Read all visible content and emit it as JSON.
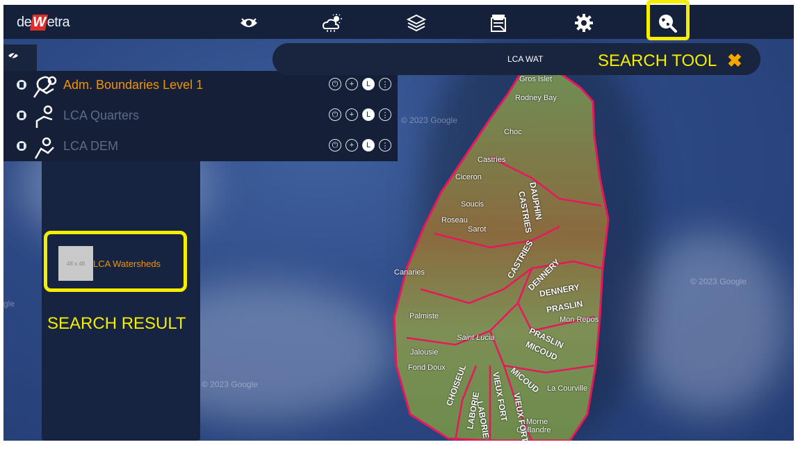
{
  "app": {
    "logo_prefix": "de",
    "logo_mark": "W",
    "logo_suffix": "etra"
  },
  "toolbar": {
    "icons": [
      "eye-icon",
      "weather-icon",
      "layers-icon",
      "documents-icon",
      "gear-icon",
      "globe-search-icon"
    ]
  },
  "search": {
    "query": "LCA WAT",
    "tool_label": "SEARCH TOOL",
    "close_glyph": "✖"
  },
  "layers": [
    {
      "name": "Adm. Boundaries Level 1",
      "color": "#f39200"
    },
    {
      "name": "LCA Quarters",
      "color": "#5e6b86"
    },
    {
      "name": "LCA DEM",
      "color": "#5e6b86"
    }
  ],
  "results": {
    "thumb_text": "48 x 48",
    "item_name": "LCA Watersheds",
    "label": "SEARCH RESULT"
  },
  "map": {
    "watermark": "© 2023 Google",
    "watermark_edge": "gle",
    "places": [
      "Gros Islet",
      "Rodney Bay",
      "Choc",
      "Castries",
      "Ciceron",
      "Soucis",
      "Roseau",
      "Sarot",
      "Canaries",
      "Palmiste",
      "Saint Lucia",
      "Jalousie",
      "Fond Doux",
      "Mon Repos",
      "La Courville",
      "Morne",
      "Caillandre"
    ],
    "zones": [
      "DAUPHIN",
      "CASTRIES",
      "CASTRIES",
      "DENNERY",
      "DENNERY",
      "PRASLIN",
      "PRASLIN",
      "MICOUD",
      "MICOUD",
      "CHOISEUL",
      "LABORIE",
      "LABORIE",
      "VIEUX FORT",
      "VIEUX FORT"
    ]
  },
  "colors": {
    "topbar": "#15213b",
    "highlight": "#f5ee00",
    "accent": "#f39200",
    "boundary": "#e8175d"
  }
}
